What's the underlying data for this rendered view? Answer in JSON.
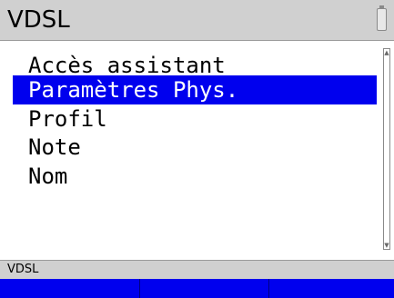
{
  "header": {
    "title": "VDSL",
    "battery_icon": "battery-icon"
  },
  "menu": {
    "items": [
      {
        "label": "Accès assistant",
        "selected": false
      },
      {
        "label": "Paramètres Phys.",
        "selected": true
      },
      {
        "label": "Profil",
        "selected": false
      },
      {
        "label": "Note",
        "selected": false
      },
      {
        "label": "Nom",
        "selected": false
      }
    ]
  },
  "scrollbar": {
    "up_arrow": "▲",
    "down_arrow": "▼"
  },
  "status": {
    "text": "VDSL"
  },
  "softkeys": {
    "left": "",
    "middle": "",
    "right": ""
  },
  "colors": {
    "selection": "#0000ee",
    "bars": "#d0d0d0",
    "softkey_bar": "#0000ee"
  }
}
